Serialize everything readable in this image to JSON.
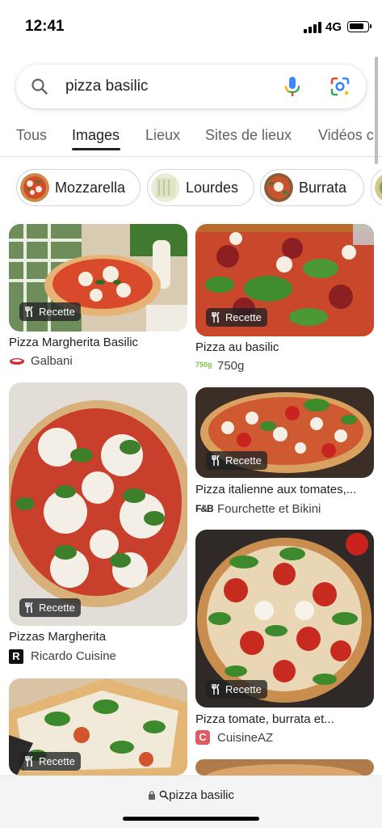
{
  "status": {
    "time": "12:41",
    "network": "4G"
  },
  "search": {
    "query": "pizza basilic"
  },
  "tabs": [
    {
      "label": "Tous"
    },
    {
      "label": "Images"
    },
    {
      "label": "Lieux"
    },
    {
      "label": "Sites de lieux"
    },
    {
      "label": "Vidéos c"
    }
  ],
  "chips": [
    {
      "label": "Mozzarella"
    },
    {
      "label": "Lourdes"
    },
    {
      "label": "Burrata"
    }
  ],
  "results": [
    {
      "title": "Pizza Margherita Basilic",
      "source": "Galbani",
      "badge": "Recette"
    },
    {
      "title": "Pizza au basilic",
      "source": "750g",
      "source_logo": "750g",
      "badge": "Recette"
    },
    {
      "title": "Pizzas Margherita",
      "source": "Ricardo Cuisine",
      "source_logo": "R",
      "badge": "Recette"
    },
    {
      "title": "Pizza italienne aux tomates,...",
      "source": "Fourchette et Bikini",
      "source_logo": "F&B",
      "badge": "Recette"
    },
    {
      "title": "Pizza tomate, burrata et...",
      "source": "CuisineAZ",
      "source_logo": "C",
      "badge": "Recette"
    },
    {
      "badge": "Recette"
    }
  ],
  "bottom_bar": {
    "url": "pizza basilic"
  },
  "colors": {
    "accent": "#202124",
    "mic_blue": "#4285f4",
    "mic_red": "#ea4335",
    "badge_bg": "#202124",
    "cuisineaz": "#e05a63"
  }
}
